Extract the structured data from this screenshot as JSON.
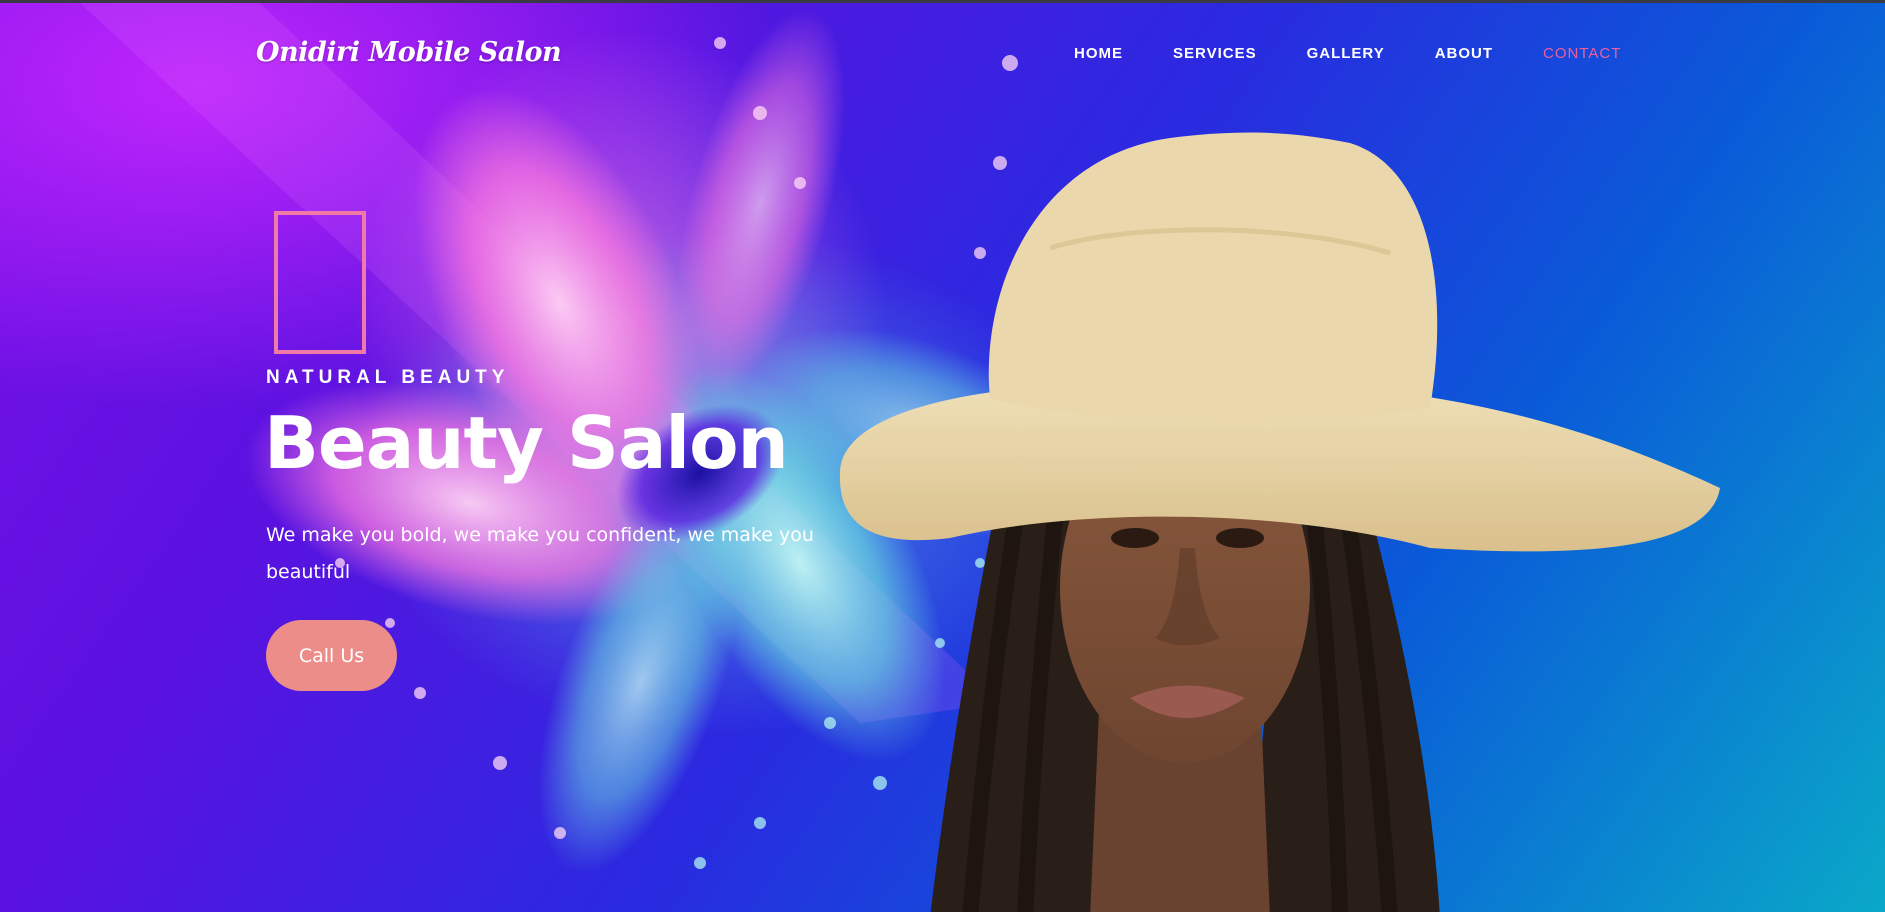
{
  "site": {
    "logo": "Onidiri Mobile Salon"
  },
  "nav": {
    "items": [
      {
        "label": "HOME"
      },
      {
        "label": "SERVICES"
      },
      {
        "label": "GALLERY"
      },
      {
        "label": "ABOUT"
      },
      {
        "label": "CONTACT",
        "active": true
      }
    ]
  },
  "hero": {
    "eyebrow": "NATURAL BEAUTY",
    "title": "Beauty Salon",
    "tagline": "We make you bold, we make you confident, we make you beautiful",
    "cta_label": "Call Us"
  },
  "colors": {
    "accent_pink": "#ee5f9c",
    "frame_pink": "#f07aa6",
    "button_salmon": "#ec8d8a",
    "gradient_purple": "#7a10e8",
    "gradient_blue": "#2a2ae0",
    "gradient_teal": "#0aa8c8",
    "hat": "#e8d4a4"
  },
  "icons": {
    "hero_frame": "outline-rectangle-icon"
  }
}
